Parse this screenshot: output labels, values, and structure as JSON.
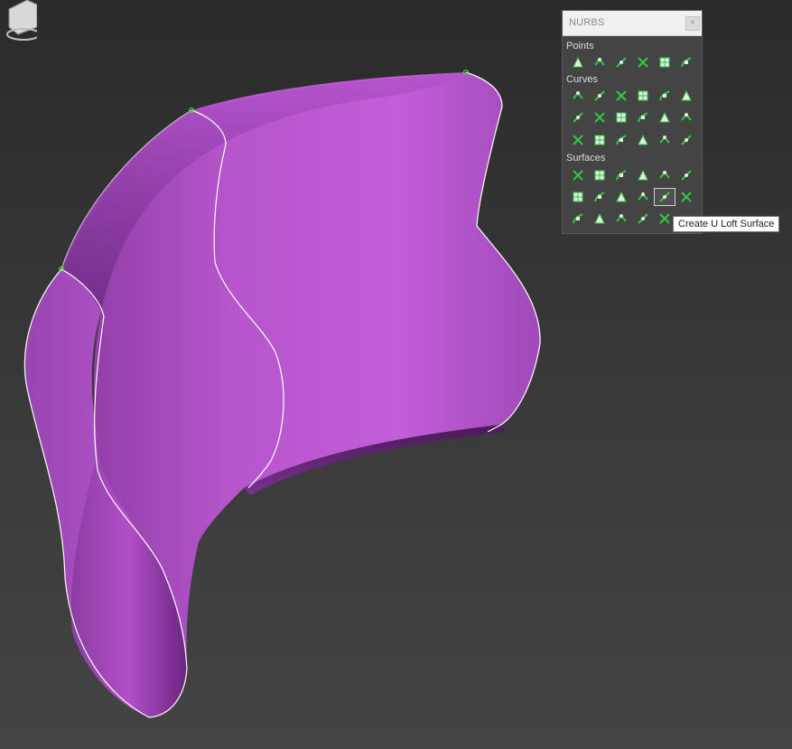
{
  "viewport": {
    "object": "nurbs-loft-surface",
    "surface_color": "#c05cd6",
    "isoline_color": "#ffffff",
    "cv_color": "#3cd23c",
    "background_top": "#2b2b2b",
    "background_bottom": "#444444"
  },
  "nurbs_panel": {
    "title": "NURBS",
    "close_glyph": "×",
    "sections": {
      "points": {
        "label": "Points",
        "buttons": [
          {
            "name": "create-point",
            "icon": "triangle-icon"
          },
          {
            "name": "create-offset-point",
            "icon": "point-offset-icon"
          },
          {
            "name": "create-curve-point",
            "icon": "curve-point-icon"
          },
          {
            "name": "create-curve-curve-point",
            "icon": "curve-curve-point-icon"
          },
          {
            "name": "create-surface-point",
            "icon": "surface-point-icon"
          },
          {
            "name": "create-surface-curve-point",
            "icon": "surface-curve-point-icon"
          }
        ]
      },
      "curves": {
        "label": "Curves",
        "rows": [
          [
            {
              "name": "create-cv-curve",
              "icon": "cv-curve-icon"
            },
            {
              "name": "create-point-curve",
              "icon": "point-curve-icon"
            },
            {
              "name": "create-fit-curve",
              "icon": "fit-curve-icon"
            },
            {
              "name": "create-transform-curve",
              "icon": "transform-curve-icon"
            },
            {
              "name": "create-blend-curve",
              "icon": "blend-curve-icon"
            },
            {
              "name": "create-offset-curve",
              "icon": "offset-curve-icon"
            }
          ],
          [
            {
              "name": "create-mirror-curve",
              "icon": "mirror-curve-icon"
            },
            {
              "name": "create-chamfer-curve",
              "icon": "chamfer-curve-icon"
            },
            {
              "name": "create-fillet-curve",
              "icon": "fillet-curve-icon"
            },
            {
              "name": "create-surface-surface-intersection-curve",
              "icon": "intersection-curve-icon"
            },
            {
              "name": "create-u-iso-curve",
              "icon": "u-iso-curve-icon"
            },
            {
              "name": "create-v-iso-curve",
              "icon": "v-iso-curve-icon"
            }
          ],
          [
            {
              "name": "create-normal-projected-curve",
              "icon": "normal-projected-icon"
            },
            {
              "name": "create-vector-projected-curve",
              "icon": "vector-projected-icon"
            },
            {
              "name": "create-cv-curve-on-surface",
              "icon": "cv-on-surface-icon"
            },
            {
              "name": "create-point-curve-on-surface",
              "icon": "point-on-surface-icon"
            },
            {
              "name": "create-surface-offset-curve",
              "icon": "surface-offset-curve-icon"
            },
            {
              "name": "create-surface-edge-curve",
              "icon": "surface-edge-curve-icon"
            }
          ]
        ]
      },
      "surfaces": {
        "label": "Surfaces",
        "rows": [
          [
            {
              "name": "create-cv-surface",
              "icon": "cv-surface-icon"
            },
            {
              "name": "create-point-surface",
              "icon": "point-surface-icon"
            },
            {
              "name": "create-transform-surface",
              "icon": "transform-surface-icon"
            },
            {
              "name": "create-blend-surface",
              "icon": "blend-surface-icon"
            },
            {
              "name": "create-offset-surface",
              "icon": "offset-surface-icon"
            },
            {
              "name": "create-mirror-surface",
              "icon": "mirror-surface-icon"
            }
          ],
          [
            {
              "name": "create-extrude-surface",
              "icon": "extrude-surface-icon"
            },
            {
              "name": "create-lathe-surface",
              "icon": "lathe-surface-icon"
            },
            {
              "name": "create-ruled-surface",
              "icon": "ruled-surface-icon"
            },
            {
              "name": "create-cap-surface",
              "icon": "cap-surface-icon"
            },
            {
              "name": "create-u-loft-surface",
              "icon": "u-loft-surface-icon",
              "hover": true
            },
            {
              "name": "create-uv-loft-surface",
              "icon": "uv-loft-surface-icon"
            }
          ],
          [
            {
              "name": "create-1-rail-sweep",
              "icon": "one-rail-sweep-icon"
            },
            {
              "name": "create-2-rail-sweep",
              "icon": "two-rail-sweep-icon"
            },
            {
              "name": "create-multisided-blend",
              "icon": "multisided-blend-icon"
            },
            {
              "name": "create-multicurve-trimmed-surface",
              "icon": "multicurve-trim-icon"
            },
            {
              "name": "create-fillet-surface",
              "icon": "fillet-surface-icon"
            }
          ]
        ]
      }
    }
  },
  "tooltip": {
    "text": "Create U Loft Surface"
  }
}
